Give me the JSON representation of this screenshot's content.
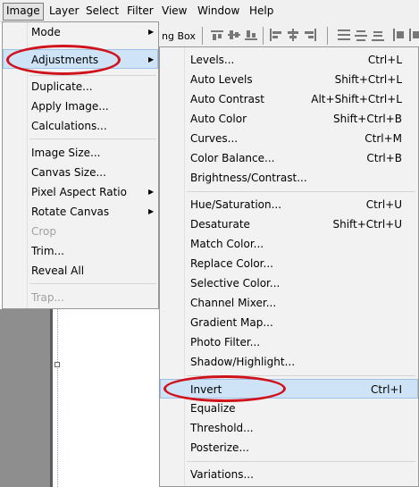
{
  "menubar": [
    "Image",
    "Layer",
    "Select",
    "Filter",
    "View",
    "Window",
    "Help"
  ],
  "options_bar": {
    "label": "ng Box"
  },
  "image_menu": {
    "items": [
      {
        "label": "Mode",
        "submenu": true
      },
      {
        "label": "Adjustments",
        "submenu": true
      },
      {
        "label": "Duplicate..."
      },
      {
        "label": "Apply Image..."
      },
      {
        "label": "Calculations..."
      },
      {
        "label": "Image Size..."
      },
      {
        "label": "Canvas Size..."
      },
      {
        "label": "Pixel Aspect Ratio",
        "submenu": true
      },
      {
        "label": "Rotate Canvas",
        "submenu": true
      },
      {
        "label": "Crop",
        "disabled": true
      },
      {
        "label": "Trim..."
      },
      {
        "label": "Reveal All"
      },
      {
        "label": "Trap...",
        "disabled": true
      }
    ]
  },
  "adjustments_menu": {
    "items": [
      {
        "label": "Levels...",
        "shortcut": "Ctrl+L"
      },
      {
        "label": "Auto Levels",
        "shortcut": "Shift+Ctrl+L"
      },
      {
        "label": "Auto Contrast",
        "shortcut": "Alt+Shift+Ctrl+L"
      },
      {
        "label": "Auto Color",
        "shortcut": "Shift+Ctrl+B"
      },
      {
        "label": "Curves...",
        "shortcut": "Ctrl+M"
      },
      {
        "label": "Color Balance...",
        "shortcut": "Ctrl+B"
      },
      {
        "label": "Brightness/Contrast...",
        "shortcut": ""
      },
      {
        "label": "Hue/Saturation...",
        "shortcut": "Ctrl+U"
      },
      {
        "label": "Desaturate",
        "shortcut": "Shift+Ctrl+U"
      },
      {
        "label": "Match Color...",
        "shortcut": ""
      },
      {
        "label": "Replace Color...",
        "shortcut": ""
      },
      {
        "label": "Selective Color...",
        "shortcut": ""
      },
      {
        "label": "Channel Mixer...",
        "shortcut": ""
      },
      {
        "label": "Gradient Map...",
        "shortcut": ""
      },
      {
        "label": "Photo Filter...",
        "shortcut": ""
      },
      {
        "label": "Shadow/Highlight...",
        "shortcut": ""
      },
      {
        "label": "Invert",
        "shortcut": "Ctrl+I"
      },
      {
        "label": "Equalize",
        "shortcut": ""
      },
      {
        "label": "Threshold...",
        "shortcut": ""
      },
      {
        "label": "Posterize...",
        "shortcut": ""
      },
      {
        "label": "Variations...",
        "shortcut": ""
      }
    ]
  },
  "colors": {
    "highlight": "#cfe3f7",
    "annotation_red": "#d0121c",
    "disabled_text": "#a0a0a0"
  }
}
